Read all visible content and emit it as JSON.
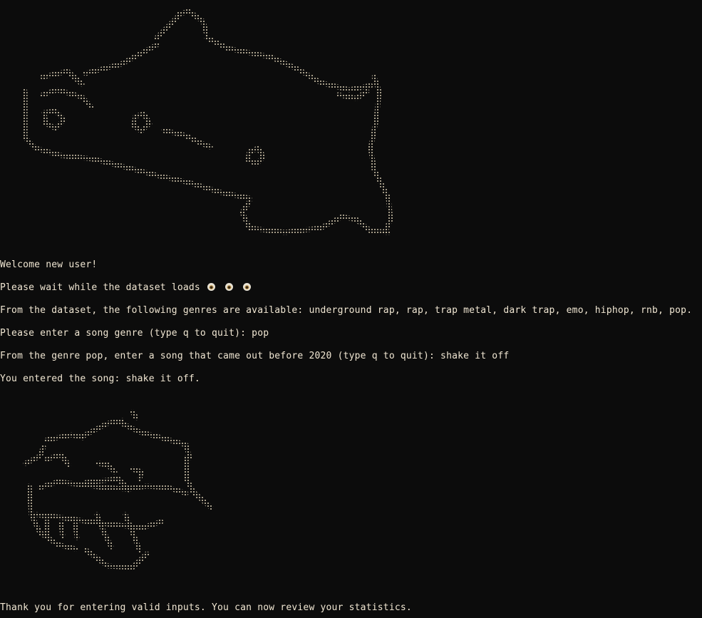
{
  "terminal": {
    "background": "#0c0c0c",
    "text_color": "#f0e6d2",
    "art_color": "#d8ccb2",
    "lines": {
      "welcome": "Welcome new user!",
      "wait": "Please wait while the dataset loads",
      "genres": "From the dataset, the following genres are available: underground rap, rap, trap metal, dark trap, emo, hiphop, rnb, pop.",
      "genre_prompt": "Please enter a song genre (type q to quit): pop",
      "song_prompt": "From the genre pop, enter a song that came out before 2020 (type q to quit): shake it off",
      "entered": "You entered the song: shake it off.",
      "thanks": "Thank you for entering valid inputs. You can now review your statistics."
    },
    "loading_icons": [
      "spinner-icon",
      "spinner-icon",
      "spinner-icon"
    ],
    "ascii_art": [
      "cat-ascii-art",
      "cupcake-ascii-art"
    ]
  }
}
